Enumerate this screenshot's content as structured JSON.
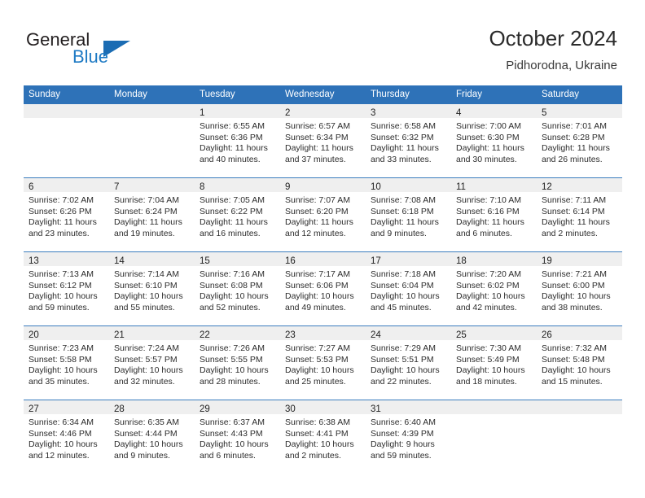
{
  "brand": {
    "name_part1": "General",
    "name_part2": "Blue",
    "triangle_color": "#1b6cb3",
    "blue_text_color": "#1e7ac4"
  },
  "header": {
    "title": "October 2024",
    "subtitle": "Pidhorodna, Ukraine"
  },
  "theme": {
    "header_blue": "#2e72b8",
    "row_divider_blue": "#3b7dbe",
    "date_band_gray": "#efefef"
  },
  "weekday_headers": [
    "Sunday",
    "Monday",
    "Tuesday",
    "Wednesday",
    "Thursday",
    "Friday",
    "Saturday"
  ],
  "weeks": [
    [
      {
        "day": "",
        "sunrise": "",
        "sunset": "",
        "daylight_line1": "",
        "daylight_line2": ""
      },
      {
        "day": "",
        "sunrise": "",
        "sunset": "",
        "daylight_line1": "",
        "daylight_line2": ""
      },
      {
        "day": "1",
        "sunrise": "Sunrise: 6:55 AM",
        "sunset": "Sunset: 6:36 PM",
        "daylight_line1": "Daylight: 11 hours",
        "daylight_line2": "and 40 minutes."
      },
      {
        "day": "2",
        "sunrise": "Sunrise: 6:57 AM",
        "sunset": "Sunset: 6:34 PM",
        "daylight_line1": "Daylight: 11 hours",
        "daylight_line2": "and 37 minutes."
      },
      {
        "day": "3",
        "sunrise": "Sunrise: 6:58 AM",
        "sunset": "Sunset: 6:32 PM",
        "daylight_line1": "Daylight: 11 hours",
        "daylight_line2": "and 33 minutes."
      },
      {
        "day": "4",
        "sunrise": "Sunrise: 7:00 AM",
        "sunset": "Sunset: 6:30 PM",
        "daylight_line1": "Daylight: 11 hours",
        "daylight_line2": "and 30 minutes."
      },
      {
        "day": "5",
        "sunrise": "Sunrise: 7:01 AM",
        "sunset": "Sunset: 6:28 PM",
        "daylight_line1": "Daylight: 11 hours",
        "daylight_line2": "and 26 minutes."
      }
    ],
    [
      {
        "day": "6",
        "sunrise": "Sunrise: 7:02 AM",
        "sunset": "Sunset: 6:26 PM",
        "daylight_line1": "Daylight: 11 hours",
        "daylight_line2": "and 23 minutes."
      },
      {
        "day": "7",
        "sunrise": "Sunrise: 7:04 AM",
        "sunset": "Sunset: 6:24 PM",
        "daylight_line1": "Daylight: 11 hours",
        "daylight_line2": "and 19 minutes."
      },
      {
        "day": "8",
        "sunrise": "Sunrise: 7:05 AM",
        "sunset": "Sunset: 6:22 PM",
        "daylight_line1": "Daylight: 11 hours",
        "daylight_line2": "and 16 minutes."
      },
      {
        "day": "9",
        "sunrise": "Sunrise: 7:07 AM",
        "sunset": "Sunset: 6:20 PM",
        "daylight_line1": "Daylight: 11 hours",
        "daylight_line2": "and 12 minutes."
      },
      {
        "day": "10",
        "sunrise": "Sunrise: 7:08 AM",
        "sunset": "Sunset: 6:18 PM",
        "daylight_line1": "Daylight: 11 hours",
        "daylight_line2": "and 9 minutes."
      },
      {
        "day": "11",
        "sunrise": "Sunrise: 7:10 AM",
        "sunset": "Sunset: 6:16 PM",
        "daylight_line1": "Daylight: 11 hours",
        "daylight_line2": "and 6 minutes."
      },
      {
        "day": "12",
        "sunrise": "Sunrise: 7:11 AM",
        "sunset": "Sunset: 6:14 PM",
        "daylight_line1": "Daylight: 11 hours",
        "daylight_line2": "and 2 minutes."
      }
    ],
    [
      {
        "day": "13",
        "sunrise": "Sunrise: 7:13 AM",
        "sunset": "Sunset: 6:12 PM",
        "daylight_line1": "Daylight: 10 hours",
        "daylight_line2": "and 59 minutes."
      },
      {
        "day": "14",
        "sunrise": "Sunrise: 7:14 AM",
        "sunset": "Sunset: 6:10 PM",
        "daylight_line1": "Daylight: 10 hours",
        "daylight_line2": "and 55 minutes."
      },
      {
        "day": "15",
        "sunrise": "Sunrise: 7:16 AM",
        "sunset": "Sunset: 6:08 PM",
        "daylight_line1": "Daylight: 10 hours",
        "daylight_line2": "and 52 minutes."
      },
      {
        "day": "16",
        "sunrise": "Sunrise: 7:17 AM",
        "sunset": "Sunset: 6:06 PM",
        "daylight_line1": "Daylight: 10 hours",
        "daylight_line2": "and 49 minutes."
      },
      {
        "day": "17",
        "sunrise": "Sunrise: 7:18 AM",
        "sunset": "Sunset: 6:04 PM",
        "daylight_line1": "Daylight: 10 hours",
        "daylight_line2": "and 45 minutes."
      },
      {
        "day": "18",
        "sunrise": "Sunrise: 7:20 AM",
        "sunset": "Sunset: 6:02 PM",
        "daylight_line1": "Daylight: 10 hours",
        "daylight_line2": "and 42 minutes."
      },
      {
        "day": "19",
        "sunrise": "Sunrise: 7:21 AM",
        "sunset": "Sunset: 6:00 PM",
        "daylight_line1": "Daylight: 10 hours",
        "daylight_line2": "and 38 minutes."
      }
    ],
    [
      {
        "day": "20",
        "sunrise": "Sunrise: 7:23 AM",
        "sunset": "Sunset: 5:58 PM",
        "daylight_line1": "Daylight: 10 hours",
        "daylight_line2": "and 35 minutes."
      },
      {
        "day": "21",
        "sunrise": "Sunrise: 7:24 AM",
        "sunset": "Sunset: 5:57 PM",
        "daylight_line1": "Daylight: 10 hours",
        "daylight_line2": "and 32 minutes."
      },
      {
        "day": "22",
        "sunrise": "Sunrise: 7:26 AM",
        "sunset": "Sunset: 5:55 PM",
        "daylight_line1": "Daylight: 10 hours",
        "daylight_line2": "and 28 minutes."
      },
      {
        "day": "23",
        "sunrise": "Sunrise: 7:27 AM",
        "sunset": "Sunset: 5:53 PM",
        "daylight_line1": "Daylight: 10 hours",
        "daylight_line2": "and 25 minutes."
      },
      {
        "day": "24",
        "sunrise": "Sunrise: 7:29 AM",
        "sunset": "Sunset: 5:51 PM",
        "daylight_line1": "Daylight: 10 hours",
        "daylight_line2": "and 22 minutes."
      },
      {
        "day": "25",
        "sunrise": "Sunrise: 7:30 AM",
        "sunset": "Sunset: 5:49 PM",
        "daylight_line1": "Daylight: 10 hours",
        "daylight_line2": "and 18 minutes."
      },
      {
        "day": "26",
        "sunrise": "Sunrise: 7:32 AM",
        "sunset": "Sunset: 5:48 PM",
        "daylight_line1": "Daylight: 10 hours",
        "daylight_line2": "and 15 minutes."
      }
    ],
    [
      {
        "day": "27",
        "sunrise": "Sunrise: 6:34 AM",
        "sunset": "Sunset: 4:46 PM",
        "daylight_line1": "Daylight: 10 hours",
        "daylight_line2": "and 12 minutes."
      },
      {
        "day": "28",
        "sunrise": "Sunrise: 6:35 AM",
        "sunset": "Sunset: 4:44 PM",
        "daylight_line1": "Daylight: 10 hours",
        "daylight_line2": "and 9 minutes."
      },
      {
        "day": "29",
        "sunrise": "Sunrise: 6:37 AM",
        "sunset": "Sunset: 4:43 PM",
        "daylight_line1": "Daylight: 10 hours",
        "daylight_line2": "and 6 minutes."
      },
      {
        "day": "30",
        "sunrise": "Sunrise: 6:38 AM",
        "sunset": "Sunset: 4:41 PM",
        "daylight_line1": "Daylight: 10 hours",
        "daylight_line2": "and 2 minutes."
      },
      {
        "day": "31",
        "sunrise": "Sunrise: 6:40 AM",
        "sunset": "Sunset: 4:39 PM",
        "daylight_line1": "Daylight: 9 hours",
        "daylight_line2": "and 59 minutes."
      },
      {
        "day": "",
        "sunrise": "",
        "sunset": "",
        "daylight_line1": "",
        "daylight_line2": ""
      },
      {
        "day": "",
        "sunrise": "",
        "sunset": "",
        "daylight_line1": "",
        "daylight_line2": ""
      }
    ]
  ]
}
